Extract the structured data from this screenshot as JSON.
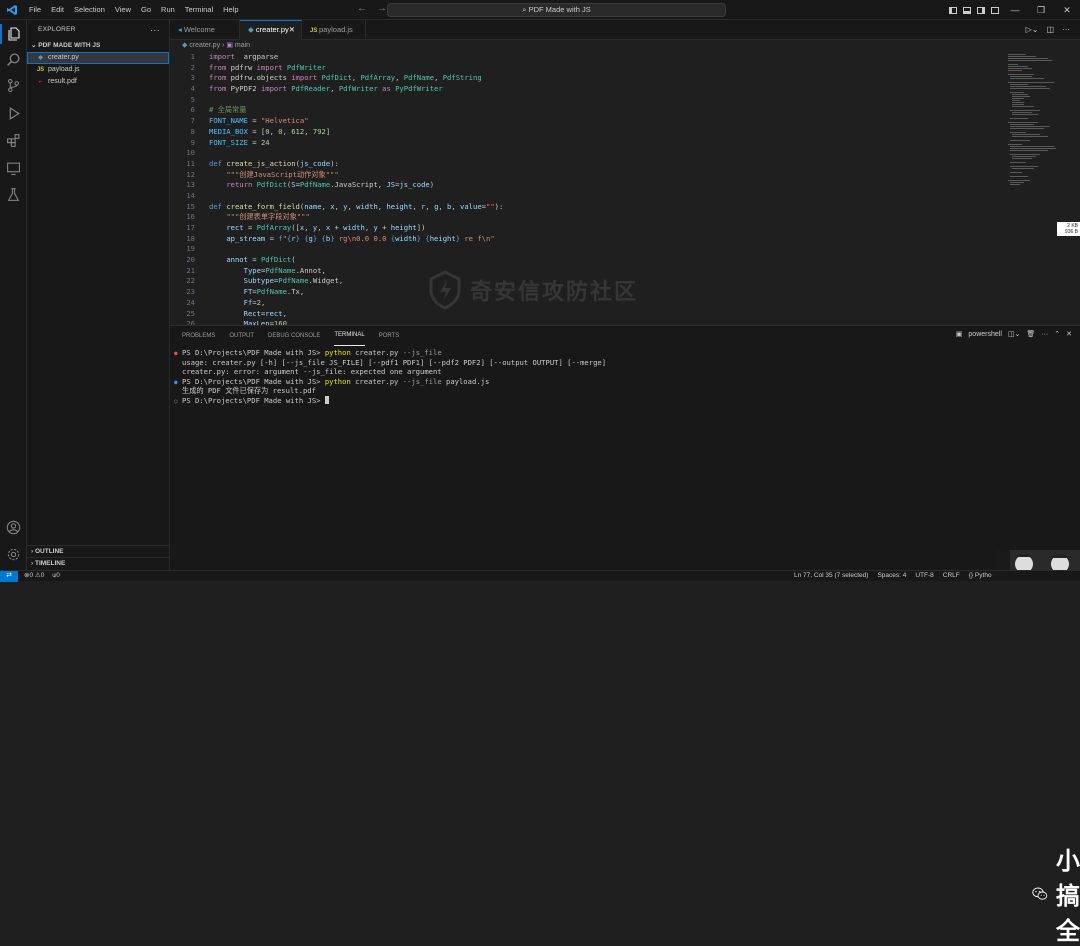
{
  "menu": [
    "File",
    "Edit",
    "Selection",
    "View",
    "Go",
    "Run",
    "Terminal",
    "Help"
  ],
  "command_center": "PDF Made with JS",
  "explorer": {
    "title": "EXPLORER",
    "folder": "PDF MADE WITH JS",
    "files": [
      {
        "name": "creater.py",
        "type": "py",
        "selected": true
      },
      {
        "name": "payload.js",
        "type": "JS",
        "selected": false
      },
      {
        "name": "result.pdf",
        "type": "pdf",
        "selected": false
      }
    ],
    "outline": "OUTLINE",
    "timeline": "TIMELINE"
  },
  "tabs": [
    {
      "label": "Welcome",
      "active": false
    },
    {
      "label": "creater.py",
      "active": true
    },
    {
      "label": "payload.js",
      "active": false
    }
  ],
  "breadcrumb": {
    "file": "creater.py",
    "symbol": "main"
  },
  "code_lines": [
    [
      [
        "kw",
        "import"
      ],
      [
        "",
        "  argparse"
      ]
    ],
    [
      [
        "kw",
        "from"
      ],
      [
        "",
        " pdfrw "
      ],
      [
        "kw",
        "import"
      ],
      [
        "",
        " "
      ],
      [
        "cls",
        "PdfWriter"
      ]
    ],
    [
      [
        "kw",
        "from"
      ],
      [
        "",
        " pdfrw.objects "
      ],
      [
        "kw",
        "import"
      ],
      [
        "",
        " "
      ],
      [
        "cls",
        "PdfDict"
      ],
      [
        "",
        ", "
      ],
      [
        "cls",
        "PdfArray"
      ],
      [
        "",
        ", "
      ],
      [
        "cls",
        "PdfName"
      ],
      [
        "",
        ", "
      ],
      [
        "cls",
        "PdfString"
      ]
    ],
    [
      [
        "kw",
        "from"
      ],
      [
        "",
        " PyPDF2 "
      ],
      [
        "kw",
        "import"
      ],
      [
        "",
        " "
      ],
      [
        "cls",
        "PdfReader"
      ],
      [
        "",
        ", "
      ],
      [
        "cls",
        "PdfWriter"
      ],
      [
        "",
        " "
      ],
      [
        "kw",
        "as"
      ],
      [
        "",
        " "
      ],
      [
        "cls",
        "PyPdfWriter"
      ]
    ],
    [],
    [
      [
        "cm",
        "# 全局常量"
      ]
    ],
    [
      [
        "const",
        "FONT_NAME"
      ],
      [
        "",
        " = "
      ],
      [
        "str",
        "\"Helvetica\""
      ]
    ],
    [
      [
        "const",
        "MEDIA_BOX"
      ],
      [
        "",
        " = ["
      ],
      [
        "num",
        "0"
      ],
      [
        "",
        ", "
      ],
      [
        "num",
        "0"
      ],
      [
        "",
        ", "
      ],
      [
        "num",
        "612"
      ],
      [
        "",
        ", "
      ],
      [
        "num",
        "792"
      ],
      [
        "",
        "]"
      ]
    ],
    [
      [
        "const",
        "FONT_SIZE"
      ],
      [
        "",
        " = "
      ],
      [
        "num",
        "24"
      ]
    ],
    [],
    [
      [
        "kb",
        "def"
      ],
      [
        "",
        " "
      ],
      [
        "fn",
        "create_js_action"
      ],
      [
        "",
        "("
      ],
      [
        "var",
        "js_code"
      ],
      [
        "",
        "):"
      ]
    ],
    [
      [
        "",
        "    "
      ],
      [
        "str",
        "\"\"\"创建JavaScript动作对象\"\"\""
      ]
    ],
    [
      [
        "",
        "    "
      ],
      [
        "kw",
        "return"
      ],
      [
        "",
        " "
      ],
      [
        "cls",
        "PdfDict"
      ],
      [
        "",
        "("
      ],
      [
        "var",
        "S"
      ],
      [
        "",
        "="
      ],
      [
        "cls",
        "PdfName"
      ],
      [
        "",
        ".JavaScript, "
      ],
      [
        "var",
        "JS"
      ],
      [
        "",
        "="
      ],
      [
        "var",
        "js_code"
      ],
      [
        "",
        ")"
      ]
    ],
    [],
    [
      [
        "kb",
        "def"
      ],
      [
        "",
        " "
      ],
      [
        "fn",
        "create_form_field"
      ],
      [
        "",
        "("
      ],
      [
        "var",
        "name"
      ],
      [
        "",
        ", "
      ],
      [
        "var",
        "x"
      ],
      [
        "",
        ", "
      ],
      [
        "var",
        "y"
      ],
      [
        "",
        ", "
      ],
      [
        "var",
        "width"
      ],
      [
        "",
        ", "
      ],
      [
        "var",
        "height"
      ],
      [
        "",
        ", "
      ],
      [
        "var",
        "r"
      ],
      [
        "",
        ", "
      ],
      [
        "var",
        "g"
      ],
      [
        "",
        ", "
      ],
      [
        "var",
        "b"
      ],
      [
        "",
        ", "
      ],
      [
        "var",
        "value"
      ],
      [
        "",
        "="
      ],
      [
        "str",
        "\"\""
      ],
      [
        "",
        "):"
      ]
    ],
    [
      [
        "",
        "    "
      ],
      [
        "str",
        "\"\"\"创建表单字段对象\"\"\""
      ]
    ],
    [
      [
        "",
        "    "
      ],
      [
        "var",
        "rect"
      ],
      [
        "",
        " = "
      ],
      [
        "cls",
        "PdfArray"
      ],
      [
        "",
        "(["
      ],
      [
        "var",
        "x"
      ],
      [
        "",
        ", "
      ],
      [
        "var",
        "y"
      ],
      [
        "",
        ", "
      ],
      [
        "var",
        "x"
      ],
      [
        "",
        " + "
      ],
      [
        "var",
        "width"
      ],
      [
        "",
        ", "
      ],
      [
        "var",
        "y"
      ],
      [
        "",
        " + "
      ],
      [
        "var",
        "height"
      ],
      [
        "",
        "])"
      ]
    ],
    [
      [
        "",
        "    "
      ],
      [
        "var",
        "ap_stream"
      ],
      [
        "",
        " = "
      ],
      [
        "kb",
        "f"
      ],
      [
        "str",
        "\""
      ],
      [
        "kb",
        "{"
      ],
      [
        "var",
        "r"
      ],
      [
        "kb",
        "}"
      ],
      [
        "str",
        " "
      ],
      [
        "kb",
        "{"
      ],
      [
        "var",
        "g"
      ],
      [
        "kb",
        "}"
      ],
      [
        "str",
        " "
      ],
      [
        "kb",
        "{"
      ],
      [
        "var",
        "b"
      ],
      [
        "kb",
        "}"
      ],
      [
        "str",
        " rg\\n0.0 0.0 "
      ],
      [
        "kb",
        "{"
      ],
      [
        "var",
        "width"
      ],
      [
        "kb",
        "}"
      ],
      [
        "str",
        " "
      ],
      [
        "kb",
        "{"
      ],
      [
        "var",
        "height"
      ],
      [
        "kb",
        "}"
      ],
      [
        "str",
        " re f\\n\""
      ]
    ],
    [],
    [
      [
        "",
        "    "
      ],
      [
        "var",
        "annot"
      ],
      [
        "",
        " = "
      ],
      [
        "cls",
        "PdfDict"
      ],
      [
        "",
        "("
      ]
    ],
    [
      [
        "",
        "        "
      ],
      [
        "var",
        "Type"
      ],
      [
        "",
        "="
      ],
      [
        "cls",
        "PdfName"
      ],
      [
        "",
        ".Annot,"
      ]
    ],
    [
      [
        "",
        "        "
      ],
      [
        "var",
        "Subtype"
      ],
      [
        "",
        "="
      ],
      [
        "cls",
        "PdfName"
      ],
      [
        "",
        ".Widget,"
      ]
    ],
    [
      [
        "",
        "        "
      ],
      [
        "var",
        "FT"
      ],
      [
        "",
        "="
      ],
      [
        "cls",
        "PdfName"
      ],
      [
        "",
        ".Tx,"
      ]
    ],
    [
      [
        "",
        "        "
      ],
      [
        "var",
        "Ff"
      ],
      [
        "",
        "="
      ],
      [
        "num",
        "2"
      ],
      [
        "",
        ","
      ]
    ],
    [
      [
        "",
        "        "
      ],
      [
        "var",
        "Rect"
      ],
      [
        "",
        "="
      ],
      [
        "var",
        "rect"
      ],
      [
        "",
        ","
      ]
    ],
    [
      [
        "",
        "        "
      ],
      [
        "var",
        "MaxLen"
      ],
      [
        "",
        "="
      ],
      [
        "num",
        "160"
      ],
      [
        "",
        ","
      ]
    ]
  ],
  "panel_tabs": [
    "PROBLEMS",
    "OUTPUT",
    "DEBUG CONSOLE",
    "TERMINAL",
    "PORTS"
  ],
  "panel_active": "TERMINAL",
  "terminal_profile": "powershell",
  "terminal": [
    {
      "dot": "red",
      "prompt": "PS D:\\Projects\\PDF Made with JS> ",
      "cmd": "python",
      "args": " creater.py ",
      "flag": "--js_file",
      "rest": ""
    },
    {
      "dot": "",
      "text": "usage: creater.py [-h] [--js_file JS_FILE] [--pdf1 PDF1] [--pdf2 PDF2] [--output OUTPUT] [--merge]"
    },
    {
      "dot": "",
      "text": "creater.py: error: argument --js_file: expected one argument"
    },
    {
      "dot": "blue",
      "prompt": "PS D:\\Projects\\PDF Made with JS> ",
      "cmd": "python",
      "args": " creater.py ",
      "flag": "--js_file",
      "rest": " payload.js"
    },
    {
      "dot": "",
      "text": "生成的 PDF 文件已保存为 result.pdf"
    },
    {
      "dot": "hollow",
      "prompt": "PS D:\\Projects\\PDF Made with JS> ",
      "cmd": "",
      "args": "",
      "flag": "",
      "rest": "",
      "cursor": true
    }
  ],
  "status": {
    "errors": "0",
    "warnings": "0",
    "ports": "0",
    "position": "Ln 77, Col 35 (7 selected)",
    "spaces": "Spaces: 4",
    "encoding": "UTF-8",
    "eol": "CRLF",
    "language": "Pytho"
  },
  "scroll_size": [
    "2 KB",
    "936 B"
  ],
  "watermark": "奇安信攻防社区",
  "wechat": "小艾搞安全",
  "colors": {
    "accent": "#0078d4",
    "bg": "#1f1f1f",
    "sidebar": "#181818"
  }
}
